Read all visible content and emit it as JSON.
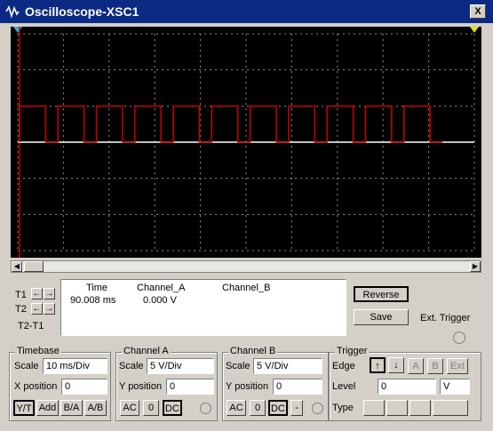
{
  "window": {
    "title": "Oscilloscope-XSC1",
    "close_label": "X"
  },
  "readout": {
    "headers": {
      "time": "Time",
      "channel_a": "Channel_A",
      "channel_b": "Channel_B"
    },
    "t1_label": "T1",
    "t2_label": "T2",
    "t2t1_label": "T2-T1",
    "time_value": "90.008 ms",
    "channel_a_value": "0.000 V"
  },
  "buttons": {
    "reverse": "Reverse",
    "save": "Save",
    "ext_trigger": "Ext. Trigger"
  },
  "timebase": {
    "title": "Timebase",
    "scale_label": "Scale",
    "scale_value": "10 ms/Div",
    "xpos_label": "X position",
    "xpos_value": "0",
    "modes": [
      "Y/T",
      "Add",
      "B/A",
      "A/B"
    ]
  },
  "channel_a": {
    "title": "Channel A",
    "scale_label": "Scale",
    "scale_value": "5  V/Div",
    "ypos_label": "Y position",
    "ypos_value": "0",
    "coupling": [
      "AC",
      "0",
      "DC"
    ]
  },
  "channel_b": {
    "title": "Channel B",
    "scale_label": "Scale",
    "scale_value": "5  V/Div",
    "ypos_label": "Y position",
    "ypos_value": "0",
    "coupling": [
      "AC",
      "0",
      "DC",
      "-"
    ]
  },
  "trigger": {
    "title": "Trigger",
    "edge_label": "Edge",
    "sources": [
      "A",
      "B",
      "Ext"
    ],
    "level_label": "Level",
    "level_value": "0",
    "level_unit": "V",
    "type_label": "Type"
  },
  "colors": {
    "channel_a": "#cc0000",
    "channel_b": "#ffffff",
    "screen_bg": "#000000",
    "grid": "#8a8a8a"
  },
  "waveform": {
    "type": "square",
    "cycles": 11,
    "duty": 0.68,
    "high_div": 1.0,
    "low_div": 0.0
  }
}
